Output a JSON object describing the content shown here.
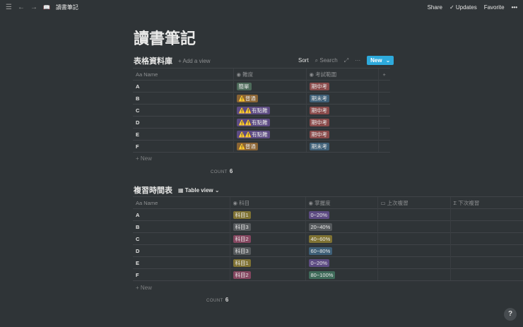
{
  "topbar": {
    "page": "讀書筆記",
    "share": "Share",
    "updates": "Updates",
    "favorite": "Favorite"
  },
  "title": "讀書筆記",
  "db1": {
    "title": "表格資料庫",
    "add_view": "Add a view",
    "sort": "Sort",
    "search": "Search",
    "new": "New",
    "headers": [
      "Name",
      "難度",
      "考試範圍"
    ],
    "rows": [
      {
        "name": "A",
        "diff": "簡單",
        "diff_color": "#4d6b5a",
        "range": "期中考",
        "range_color": "#8a4b4b"
      },
      {
        "name": "B",
        "diff": "⚠️普通",
        "diff_color": "#8a6434",
        "range": "期末考",
        "range_color": "#3e5f77"
      },
      {
        "name": "C",
        "diff": "⚠️⚠️有點難",
        "diff_color": "#5d4b83",
        "range": "期中考",
        "range_color": "#8a4b4b"
      },
      {
        "name": "D",
        "diff": "⚠️⚠️有點難",
        "diff_color": "#5d4b83",
        "range": "期中考",
        "range_color": "#8a4b4b"
      },
      {
        "name": "E",
        "diff": "⚠️⚠️有點難",
        "diff_color": "#5d4b83",
        "range": "期中考",
        "range_color": "#8a4b4b"
      },
      {
        "name": "F",
        "diff": "⚠️普通",
        "diff_color": "#8a6434",
        "range": "期末考",
        "range_color": "#3e5f77"
      }
    ],
    "new_row": "New",
    "count_label": "COUNT",
    "count": "6"
  },
  "db2": {
    "title": "複習時間表",
    "view": "Table view",
    "headers": [
      "Name",
      "科目",
      "掌握度",
      "上次複習",
      "下次複習"
    ],
    "rows": [
      {
        "name": "A",
        "subj": "科目1",
        "subj_color": "#7f7233",
        "lvl": "0~20%",
        "lvl_color": "#5d4b83"
      },
      {
        "name": "B",
        "subj": "科目3",
        "subj_color": "#55595c",
        "lvl": "20~40%",
        "lvl_color": "#55595c"
      },
      {
        "name": "C",
        "subj": "科目2",
        "subj_color": "#84465f",
        "lvl": "40~60%",
        "lvl_color": "#7f7233"
      },
      {
        "name": "D",
        "subj": "科目3",
        "subj_color": "#55595c",
        "lvl": "60~80%",
        "lvl_color": "#3e5f77"
      },
      {
        "name": "E",
        "subj": "科目1",
        "subj_color": "#7f7233",
        "lvl": "0~20%",
        "lvl_color": "#5d4b83"
      },
      {
        "name": "F",
        "subj": "科目2",
        "subj_color": "#84465f",
        "lvl": "80~100%",
        "lvl_color": "#3f6b5a"
      }
    ],
    "new_row": "New",
    "count_label": "COUNT",
    "count": "6"
  },
  "help": "?"
}
